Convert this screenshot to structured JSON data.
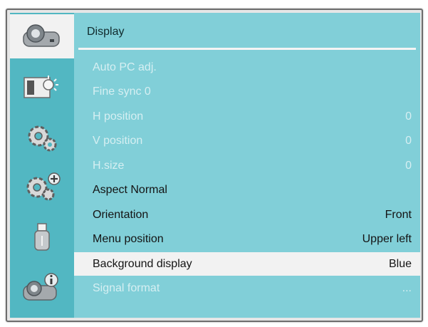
{
  "sidebar": {
    "tabs": [
      {
        "icon": "projector-icon",
        "active": true
      },
      {
        "icon": "picture-adjust-icon",
        "active": false
      },
      {
        "icon": "settings-gear-icon",
        "active": false
      },
      {
        "icon": "expanded-settings-icon",
        "active": false
      },
      {
        "icon": "usb-icon",
        "active": false
      },
      {
        "icon": "projector-info-icon",
        "active": false
      }
    ]
  },
  "panel": {
    "title": "Display",
    "items": [
      {
        "label": "Auto PC adj.",
        "value": "",
        "state": "disabled"
      },
      {
        "label": "Fine sync 0",
        "value": "",
        "state": "disabled"
      },
      {
        "label": "H position",
        "value": "0",
        "state": "disabled"
      },
      {
        "label": "V position",
        "value": "0",
        "state": "disabled"
      },
      {
        "label": "H.size",
        "value": "0",
        "state": "disabled"
      },
      {
        "label": "Aspect Normal",
        "value": "",
        "state": "enabled"
      },
      {
        "label": "Orientation",
        "value": "Front",
        "state": "enabled"
      },
      {
        "label": "Menu position",
        "value": "Upper left",
        "state": "enabled"
      },
      {
        "label": "Background display",
        "value": "Blue",
        "state": "selected"
      },
      {
        "label": "Signal format",
        "value": "...",
        "state": "disabled"
      }
    ]
  },
  "colors": {
    "sidebar": "#52b7c2",
    "panel": "#81cfd8",
    "selected_row": "#f2f2f2",
    "disabled_text": "#d6eff2",
    "enabled_text": "#141414"
  }
}
